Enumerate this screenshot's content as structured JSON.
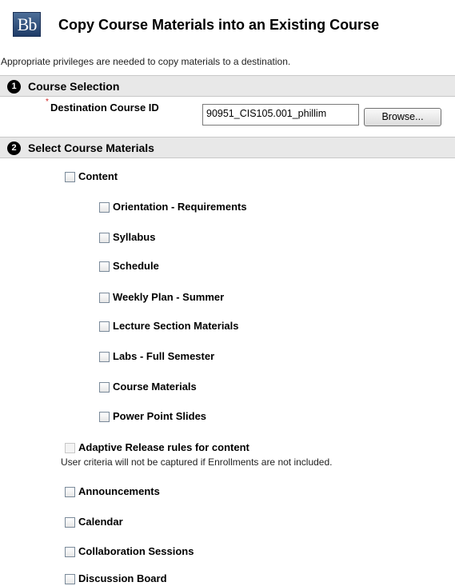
{
  "header": {
    "logo_text": "Bb",
    "title": "Copy Course Materials into an Existing Course"
  },
  "info_text": "Appropriate privileges are needed to copy materials to a destination.",
  "step1": {
    "number": "1",
    "title": "Course Selection",
    "required_mark": "*",
    "destination_label": "Destination Course ID",
    "destination_value": "90951_CIS105.001_phillim",
    "browse_label": "Browse..."
  },
  "step2": {
    "number": "2",
    "title": "Select Course Materials",
    "content_label": "Content",
    "content_items": [
      "Orientation - Requirements",
      "Syllabus",
      "Schedule",
      "Weekly Plan - Summer",
      "Lecture Section Materials",
      "Labs - Full Semester",
      "Course Materials",
      "Power Point Slides"
    ],
    "adaptive_label": "Adaptive Release rules for content",
    "adaptive_note": "User criteria will not be captured if Enrollments are not included.",
    "other_items": [
      "Announcements",
      "Calendar",
      "Collaboration Sessions",
      "Discussion Board"
    ]
  }
}
